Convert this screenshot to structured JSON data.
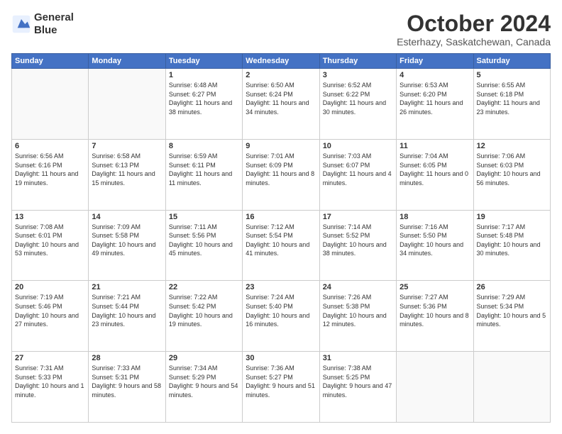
{
  "header": {
    "logo_line1": "General",
    "logo_line2": "Blue",
    "title": "October 2024",
    "location": "Esterhazy, Saskatchewan, Canada"
  },
  "weekdays": [
    "Sunday",
    "Monday",
    "Tuesday",
    "Wednesday",
    "Thursday",
    "Friday",
    "Saturday"
  ],
  "weeks": [
    [
      {
        "day": "",
        "info": ""
      },
      {
        "day": "",
        "info": ""
      },
      {
        "day": "1",
        "info": "Sunrise: 6:48 AM\nSunset: 6:27 PM\nDaylight: 11 hours and 38 minutes."
      },
      {
        "day": "2",
        "info": "Sunrise: 6:50 AM\nSunset: 6:24 PM\nDaylight: 11 hours and 34 minutes."
      },
      {
        "day": "3",
        "info": "Sunrise: 6:52 AM\nSunset: 6:22 PM\nDaylight: 11 hours and 30 minutes."
      },
      {
        "day": "4",
        "info": "Sunrise: 6:53 AM\nSunset: 6:20 PM\nDaylight: 11 hours and 26 minutes."
      },
      {
        "day": "5",
        "info": "Sunrise: 6:55 AM\nSunset: 6:18 PM\nDaylight: 11 hours and 23 minutes."
      }
    ],
    [
      {
        "day": "6",
        "info": "Sunrise: 6:56 AM\nSunset: 6:16 PM\nDaylight: 11 hours and 19 minutes."
      },
      {
        "day": "7",
        "info": "Sunrise: 6:58 AM\nSunset: 6:13 PM\nDaylight: 11 hours and 15 minutes."
      },
      {
        "day": "8",
        "info": "Sunrise: 6:59 AM\nSunset: 6:11 PM\nDaylight: 11 hours and 11 minutes."
      },
      {
        "day": "9",
        "info": "Sunrise: 7:01 AM\nSunset: 6:09 PM\nDaylight: 11 hours and 8 minutes."
      },
      {
        "day": "10",
        "info": "Sunrise: 7:03 AM\nSunset: 6:07 PM\nDaylight: 11 hours and 4 minutes."
      },
      {
        "day": "11",
        "info": "Sunrise: 7:04 AM\nSunset: 6:05 PM\nDaylight: 11 hours and 0 minutes."
      },
      {
        "day": "12",
        "info": "Sunrise: 7:06 AM\nSunset: 6:03 PM\nDaylight: 10 hours and 56 minutes."
      }
    ],
    [
      {
        "day": "13",
        "info": "Sunrise: 7:08 AM\nSunset: 6:01 PM\nDaylight: 10 hours and 53 minutes."
      },
      {
        "day": "14",
        "info": "Sunrise: 7:09 AM\nSunset: 5:58 PM\nDaylight: 10 hours and 49 minutes."
      },
      {
        "day": "15",
        "info": "Sunrise: 7:11 AM\nSunset: 5:56 PM\nDaylight: 10 hours and 45 minutes."
      },
      {
        "day": "16",
        "info": "Sunrise: 7:12 AM\nSunset: 5:54 PM\nDaylight: 10 hours and 41 minutes."
      },
      {
        "day": "17",
        "info": "Sunrise: 7:14 AM\nSunset: 5:52 PM\nDaylight: 10 hours and 38 minutes."
      },
      {
        "day": "18",
        "info": "Sunrise: 7:16 AM\nSunset: 5:50 PM\nDaylight: 10 hours and 34 minutes."
      },
      {
        "day": "19",
        "info": "Sunrise: 7:17 AM\nSunset: 5:48 PM\nDaylight: 10 hours and 30 minutes."
      }
    ],
    [
      {
        "day": "20",
        "info": "Sunrise: 7:19 AM\nSunset: 5:46 PM\nDaylight: 10 hours and 27 minutes."
      },
      {
        "day": "21",
        "info": "Sunrise: 7:21 AM\nSunset: 5:44 PM\nDaylight: 10 hours and 23 minutes."
      },
      {
        "day": "22",
        "info": "Sunrise: 7:22 AM\nSunset: 5:42 PM\nDaylight: 10 hours and 19 minutes."
      },
      {
        "day": "23",
        "info": "Sunrise: 7:24 AM\nSunset: 5:40 PM\nDaylight: 10 hours and 16 minutes."
      },
      {
        "day": "24",
        "info": "Sunrise: 7:26 AM\nSunset: 5:38 PM\nDaylight: 10 hours and 12 minutes."
      },
      {
        "day": "25",
        "info": "Sunrise: 7:27 AM\nSunset: 5:36 PM\nDaylight: 10 hours and 8 minutes."
      },
      {
        "day": "26",
        "info": "Sunrise: 7:29 AM\nSunset: 5:34 PM\nDaylight: 10 hours and 5 minutes."
      }
    ],
    [
      {
        "day": "27",
        "info": "Sunrise: 7:31 AM\nSunset: 5:33 PM\nDaylight: 10 hours and 1 minute."
      },
      {
        "day": "28",
        "info": "Sunrise: 7:33 AM\nSunset: 5:31 PM\nDaylight: 9 hours and 58 minutes."
      },
      {
        "day": "29",
        "info": "Sunrise: 7:34 AM\nSunset: 5:29 PM\nDaylight: 9 hours and 54 minutes."
      },
      {
        "day": "30",
        "info": "Sunrise: 7:36 AM\nSunset: 5:27 PM\nDaylight: 9 hours and 51 minutes."
      },
      {
        "day": "31",
        "info": "Sunrise: 7:38 AM\nSunset: 5:25 PM\nDaylight: 9 hours and 47 minutes."
      },
      {
        "day": "",
        "info": ""
      },
      {
        "day": "",
        "info": ""
      }
    ]
  ]
}
